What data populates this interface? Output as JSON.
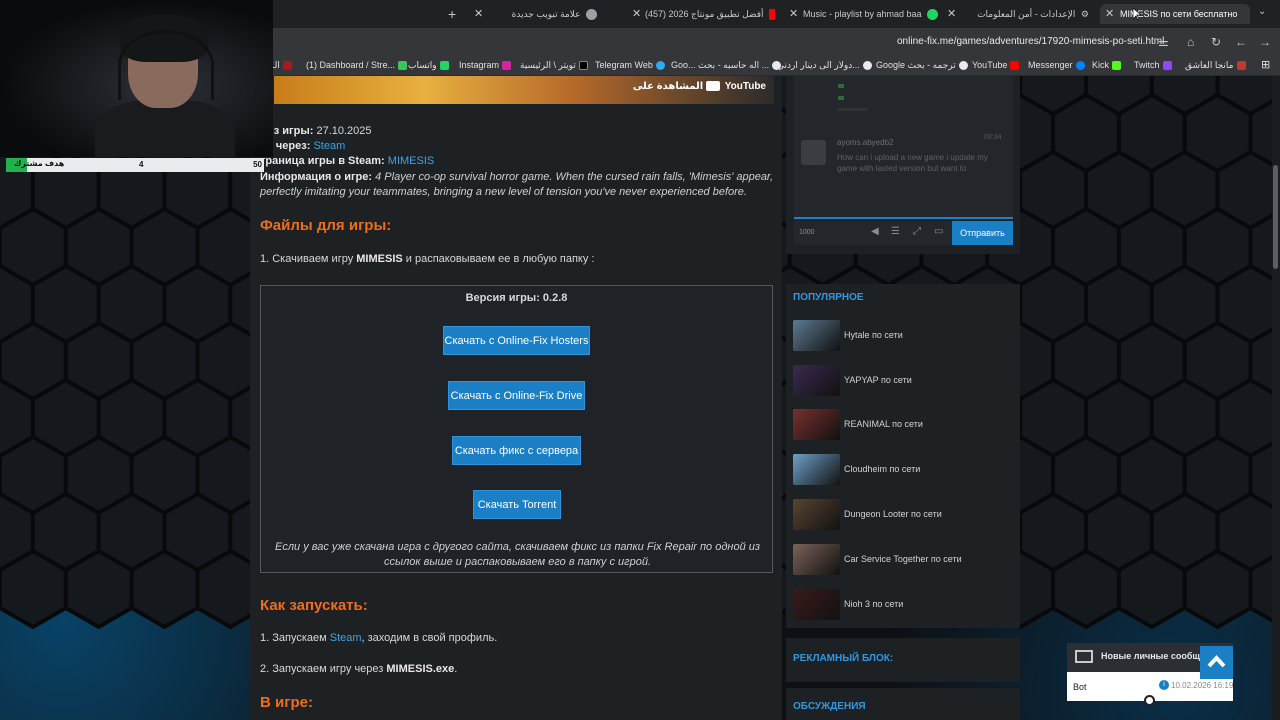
{
  "browser": {
    "tabs": [
      {
        "label": "علامة تبويب جديدة"
      },
      {
        "label": "(457) أفضل تطبيق مونتاج 2026"
      },
      {
        "label": "Music - playlist by ahmad baa"
      },
      {
        "label": "الإعدادات - أمن المعلومات"
      },
      {
        "label": "MIMESIS по сети бесплатно"
      }
    ],
    "url": "online-fix.me/games/adventures/17920-mimesis-po-seti.html",
    "bookmarks": [
      "الـ",
      "(1) Dashboard / Stre...",
      "واتساب",
      "Instagram",
      "تويتر \\ الرئيسية",
      "Telegram Web",
      "Goo...",
      "اله حاسبه - بحث ...",
      "دولار الى دينار اردني...",
      "Google ترجمه - بحث",
      "YouTube",
      "Messenger",
      "Kick",
      "Twitch",
      "مانجا العاشق"
    ]
  },
  "stream_overlay": {
    "goal_label": "هدف مشترك",
    "goal_current": "4",
    "goal_target": "50",
    "goal_fraction": 0.08
  },
  "video": {
    "watch_on": "المشاهدة على",
    "platform": "YouTube"
  },
  "game_info": {
    "release_label": "лиз игры:",
    "release_value": "27.10.2025",
    "via_label": "ра через:",
    "via_value": "Steam",
    "steam_label": "траница игры в Steam:",
    "steam_value": "MIMESIS",
    "info_label": "Информация о игре:",
    "info_text_1": "4 Player co-op survival horror game. When the cursed rain falls, 'Mimesis' appear,",
    "info_text_2": "perfectly imitating your teammates, bringing a new level of tension you've never experienced before."
  },
  "files": {
    "title": "Файлы для игры:",
    "step_prefix": "1. Скачиваем игру ",
    "step_game": "MIMESIS",
    "step_suffix": " и распаковываем ее в любую папку :",
    "version": "Версия игры: 0.2.8",
    "buttons": [
      "Скачать с Online-Fix Hosters",
      "Скачать с Online-Fix Drive",
      "Скачать фикс с сервера",
      "Скачать Torrent"
    ],
    "note_1": "Если у вас уже скачана игра с другого сайта, скачиваем фикс из папки Fix Repair по одной из",
    "note_2": "ссылок выше и распаковываем его в папку с игрой."
  },
  "launch": {
    "title": "Как запускать:",
    "step1_prefix": "1. Запускаем ",
    "step1_link": "Steam",
    "step1_suffix": ", заходим в свой профиль.",
    "step2_prefix": "2. Запускаем игру через ",
    "step2_exe": "MIMESIS.exe",
    "step2_suffix": "."
  },
  "in_game": {
    "title": "В игре:"
  },
  "chat": {
    "user": "ayoms.abyedb2",
    "message": "How can i upload a new game i update my game with lasted version but want to",
    "time": "09:34",
    "counter": "1000",
    "send_label": "Отправить"
  },
  "sidebar": {
    "popular_title": "ПОПУЛЯРНОЕ",
    "popular": [
      {
        "label": "Hytale по сети",
        "color": "#5d7a92"
      },
      {
        "label": "YAPYAP по сети",
        "color": "#3a2a4e"
      },
      {
        "label": "REANIMAL по сети",
        "color": "#7a2f2f"
      },
      {
        "label": "Cloudheim по сети",
        "color": "#6fa0c8"
      },
      {
        "label": "Dungeon Looter по сети",
        "color": "#5a4432"
      },
      {
        "label": "Car Service Together по сети",
        "color": "#7a6258"
      },
      {
        "label": "Nioh 3 по сети",
        "color": "#3a1a1a"
      }
    ],
    "ad_title": "РЕКЛАМНЫЙ БЛОК:",
    "discussions_title": "ОБСУЖДЕНИЯ"
  },
  "pm": {
    "title": "Новые личные сообщени",
    "user": "Bot",
    "time": "10.02.2026 16:19"
  },
  "colors": {
    "accent_blue": "#1b7fc6",
    "heading_orange": "#ef6c1c",
    "link_blue": "#3aa5e6",
    "goal_green": "#23b14d"
  }
}
